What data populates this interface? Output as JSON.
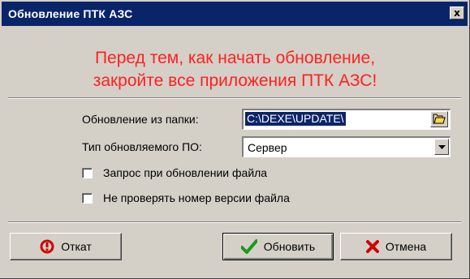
{
  "window": {
    "title": "Обновление ПТК АЗС",
    "close_glyph": "x"
  },
  "warning": {
    "line1": "Перед тем, как начать обновление,",
    "line2": "закройте все приложения ПТК АЗС!",
    "color": "#ff2020"
  },
  "form": {
    "folder_label": "Обновление из папки:",
    "folder_value": "C:\\DEXE\\UPDATE\\",
    "type_label": "Тип обновляемого ПО:",
    "type_value": "Сервер",
    "checkbox_confirm_label": "Запрос при обновлении файла",
    "checkbox_confirm_checked": false,
    "checkbox_noversion_label": "Не проверять номер версии файла",
    "checkbox_noversion_checked": false
  },
  "buttons": {
    "rollback_label": "Откат",
    "update_label": "Обновить",
    "cancel_label": "Отмена"
  },
  "icons": {
    "browse": "open-folder-icon",
    "dropdown": "chevron-down-icon",
    "rollback": "rollback-icon",
    "update": "checkmark-icon",
    "cancel": "x-icon"
  },
  "colors": {
    "titlebar": "#0a246a",
    "face": "#d4d0c8",
    "selection": "#0a246a"
  }
}
